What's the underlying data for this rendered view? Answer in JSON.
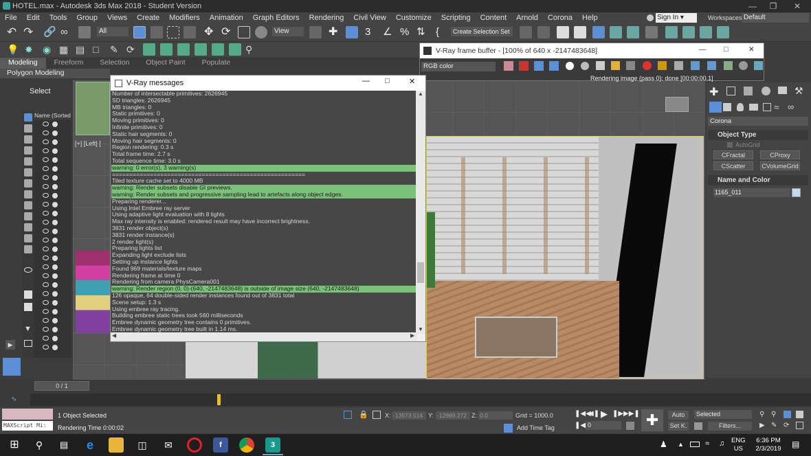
{
  "app": {
    "window_title": "HOTEL.max - Autodesk 3ds Max 2018 - Student Version"
  },
  "menu": [
    "File",
    "Edit",
    "Tools",
    "Group",
    "Views",
    "Create",
    "Modifiers",
    "Animation",
    "Graph Editors",
    "Rendering",
    "Civil View",
    "Customize",
    "Scripting",
    "Content",
    "Arnold",
    "Corona",
    "Help"
  ],
  "account": {
    "sign_in": "Sign In",
    "workspaces_label": "Workspaces:",
    "workspace_value": "Default"
  },
  "toolbar": {
    "filter_value": "All",
    "ref_coord": "View",
    "create_selection_set": "Create Selection Set"
  },
  "ribbon": {
    "tabs": [
      "Modeling",
      "Freeform",
      "Selection",
      "Object Paint",
      "Populate"
    ],
    "active_tab": "Modeling",
    "sub_label": "Polygon Modeling"
  },
  "scene_explorer": {
    "select_label": "Select",
    "column_header": "Name (Sorted",
    "viewport_label": "[+] [Left] ["
  },
  "vray_messages": {
    "title": "V-Ray messages",
    "lines": [
      {
        "text": "Number of intersectable primitives: 2626945",
        "warn": false
      },
      {
        "text": " SD triangles: 2626945",
        "warn": false
      },
      {
        "text": " MB triangles: 0",
        "warn": false
      },
      {
        "text": " Static primitives: 0",
        "warn": false
      },
      {
        "text": " Moving primitives: 0",
        "warn": false
      },
      {
        "text": " Infinite primitives: 0",
        "warn": false
      },
      {
        "text": " Static hair segments: 0",
        "warn": false
      },
      {
        "text": " Moving hair segments: 0",
        "warn": false
      },
      {
        "text": "Region rendering: 0.3 s",
        "warn": false
      },
      {
        "text": "Total frame time: 2.7 s",
        "warn": false
      },
      {
        "text": "Total sequence time: 3.0 s",
        "warn": false
      },
      {
        "text": "warning: 0 error(s), 3 warning(s)",
        "warn": true
      },
      {
        "text": "========================================================",
        "warn": false
      },
      {
        "text": "Tiled texture cache set to 4000 MB",
        "warn": false
      },
      {
        "text": "warning: Render subsets disable GI previews.",
        "warn": true
      },
      {
        "text": "warning: Render subsets and progressive sampling lead to artefacts along object edges.",
        "warn": true
      },
      {
        "text": "Preparing renderer...",
        "warn": false
      },
      {
        "text": "Using Intel Embree ray server",
        "warn": false
      },
      {
        "text": "Using adaptive light evaluation with 8 lights",
        "warn": false
      },
      {
        "text": "Max ray intensity is enabled: rendered result may have incorrect brightness.",
        "warn": false
      },
      {
        "text": "3831 render object(s)",
        "warn": false
      },
      {
        "text": "3831 render instance(s)",
        "warn": false
      },
      {
        "text": "2 render light(s)",
        "warn": false
      },
      {
        "text": "Preparing lights list",
        "warn": false
      },
      {
        "text": "Expanding light exclude lists",
        "warn": false
      },
      {
        "text": "Setting up instance lights",
        "warn": false
      },
      {
        "text": "Found 969 materials/texture maps",
        "warn": false
      },
      {
        "text": "Rendering frame at time 0",
        "warn": false
      },
      {
        "text": "Rendering from camera PhysCamera001",
        "warn": false
      },
      {
        "text": "warning: Render region (0, 0)-(640, -2147483648) is outside of image size (640, -2147483648)",
        "warn": true
      },
      {
        "text": "126 opaque, 64 double-sided render instances found out of 3831 total",
        "warn": false
      },
      {
        "text": "Scene setup: 1.3 s",
        "warn": false
      },
      {
        "text": "Using embree ray tracing.",
        "warn": false
      },
      {
        "text": "Building embree static trees took 560 milliseconds",
        "warn": false
      },
      {
        "text": "Embree dynamic geometry tree contains 0 primitives.",
        "warn": false
      },
      {
        "text": "Embree dynamic geometry tree built in 1.14 ms.",
        "warn": false
      }
    ]
  },
  "frame_buffer": {
    "title": "V-Ray frame buffer - [100% of 640 x -2147483648]",
    "channel": "RGB color",
    "status": "Rendering image (pass 0): done [00:00:00.1]"
  },
  "command_panel": {
    "dropdown": "Corona",
    "object_type_header": "Object Type",
    "autogrid": "AutoGrid",
    "buttons": [
      "CFractal",
      "CProxy",
      "CScatter",
      "CVolumeGrid"
    ],
    "name_color_header": "Name and Color",
    "object_name": "1165_011",
    "name_color_swatch": "#c8d8f0"
  },
  "timeline": {
    "frame_counter": "0 / 1"
  },
  "status": {
    "maxscript_label": "MAXScript Mi:",
    "selection": "1 Object Selected",
    "render_time": "Rendering Time  0:00:02",
    "x_label": "X:",
    "x_value": "-13573.514",
    "y_label": "Y:",
    "y_value": "-12989.272",
    "z_label": "Z:",
    "z_value": "0.0",
    "grid": "Grid = 1000.0",
    "add_time_tag": "Add Time Tag",
    "auto_key": "Auto",
    "set_key": "Set K.",
    "selected": "Selected",
    "filters": "Filters...",
    "current_frame": "0"
  },
  "taskbar": {
    "lang": "ENG",
    "region": "US",
    "time": "6:36 PM",
    "date": "2/3/2019"
  },
  "colors": {
    "warn_bg": "#7cc17a",
    "accent_blue": "#5b8fd6"
  }
}
